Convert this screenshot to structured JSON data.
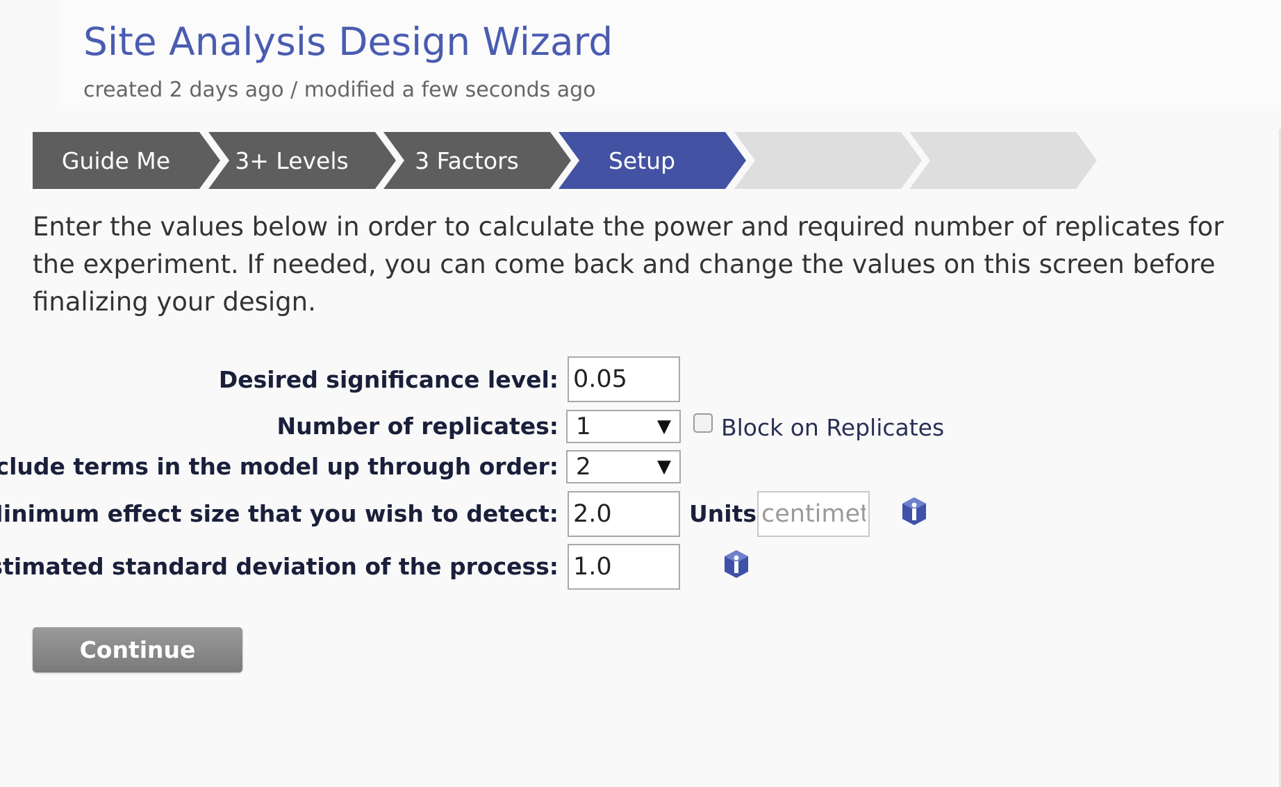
{
  "header": {
    "title": "Site Analysis Design Wizard",
    "subtitle": "created 2 days ago / modified a few seconds ago"
  },
  "steps": [
    {
      "label": "Guide Me",
      "state": "done"
    },
    {
      "label": "3+ Levels",
      "state": "done"
    },
    {
      "label": "3 Factors",
      "state": "done"
    },
    {
      "label": "Setup",
      "state": "active"
    },
    {
      "label": "",
      "state": "pending"
    },
    {
      "label": "",
      "state": "pending"
    }
  ],
  "intro": "Enter the values below in order to calculate the power and required number of replicates for the experiment. If needed, you can come back and change the values on this screen before finalizing your design.",
  "form": {
    "significance": {
      "label": "Desired significance level:",
      "value": "0.05"
    },
    "replicates": {
      "label": "Number of replicates:",
      "value": "1",
      "block_label": "Block on Replicates",
      "block_checked": false
    },
    "order": {
      "label": "Include terms in the model up through order:",
      "value": "2"
    },
    "effect": {
      "label": "Minimum effect size that you wish to detect:",
      "value": "2.0",
      "units_label": "Units",
      "units_placeholder": "centimet"
    },
    "stddev": {
      "label": "Estimated standard deviation of the process:",
      "value": "1.0"
    }
  },
  "continue_label": "Continue",
  "colors": {
    "accent": "#4452a3",
    "step_done": "#5e5e5e",
    "step_pending": "#dedede",
    "title": "#4a5cb0"
  },
  "icons": {
    "info": "info-hexagon-icon",
    "dropdown": "triangle-down-icon"
  }
}
